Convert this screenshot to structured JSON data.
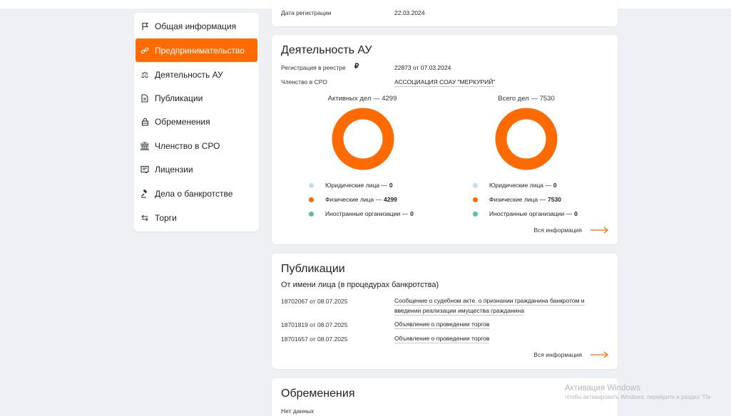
{
  "sidebar": {
    "items": [
      {
        "label": "Общая информация",
        "icon": "flag-icon"
      },
      {
        "label": "Предпринимательство",
        "icon": "link-icon",
        "active": true
      },
      {
        "label": "Деятельность АУ",
        "icon": "scales-icon"
      },
      {
        "label": "Публикации",
        "icon": "document-icon"
      },
      {
        "label": "Обременения",
        "icon": "lock-icon"
      },
      {
        "label": "Членство в СРО",
        "icon": "bank-icon"
      },
      {
        "label": "Лицензии",
        "icon": "license-icon"
      },
      {
        "label": "Дела о банкротстве",
        "icon": "gavel-icon"
      },
      {
        "label": "Торги",
        "icon": "exchange-icon"
      }
    ]
  },
  "top_card": {
    "reg_label": "Дата регистрации",
    "reg_value": "22.03.2024"
  },
  "activity": {
    "title": "Деятельность АУ",
    "registry_label": "Регистрация в реестре",
    "registry_value": "22873 от 07.03.2024",
    "sro_label": "Членство в СРО",
    "sro_value": "АССОЦИАЦИЯ СОАУ \"МЕРКУРИЙ\"",
    "charts": [
      {
        "title": "Активных дел — 4299",
        "legend": [
          {
            "label": "Юридические лица — ",
            "value": "0",
            "color": "#c5dcf2"
          },
          {
            "label": "Физические лица — ",
            "value": "4299",
            "color": "#ff6b00"
          },
          {
            "label": "Иностранные организации — ",
            "value": "0",
            "color": "#5cc28c"
          }
        ]
      },
      {
        "title": "Всего дел — 7530",
        "legend": [
          {
            "label": "Юридические лица — ",
            "value": "0",
            "color": "#c5dcf2"
          },
          {
            "label": "Физические лица — ",
            "value": "7530",
            "color": "#ff6b00"
          },
          {
            "label": "Иностранные организации — ",
            "value": "0",
            "color": "#5cc28c"
          }
        ]
      }
    ],
    "all_info": "Вся информация"
  },
  "publications": {
    "title": "Публикации",
    "subtitle": "От имени лица (в процедурах банкротства)",
    "rows": [
      {
        "id": "18702067 от 08.07.2025",
        "text": "Сообщение о судебном акте. о признании гражданина банкротом и введении реализации имущества гражданина"
      },
      {
        "id": "18701819 от 08.07.2025",
        "text": "Объявление о проведении торгов"
      },
      {
        "id": "18701657 от 08.07.2025",
        "text": "Объявление о проведении торгов"
      }
    ],
    "all_info": "Вся информация"
  },
  "encumbrances": {
    "title": "Обременения",
    "no_data": "Нет данных"
  },
  "watermark": {
    "line1": "Активация Windows",
    "line2": "Чтобы активировать Windows, перейдите в раздел \"Па"
  },
  "colors": {
    "accent": "#ff6b00",
    "legal": "#c5dcf2",
    "physical": "#ff6b00",
    "foreign": "#5cc28c"
  }
}
